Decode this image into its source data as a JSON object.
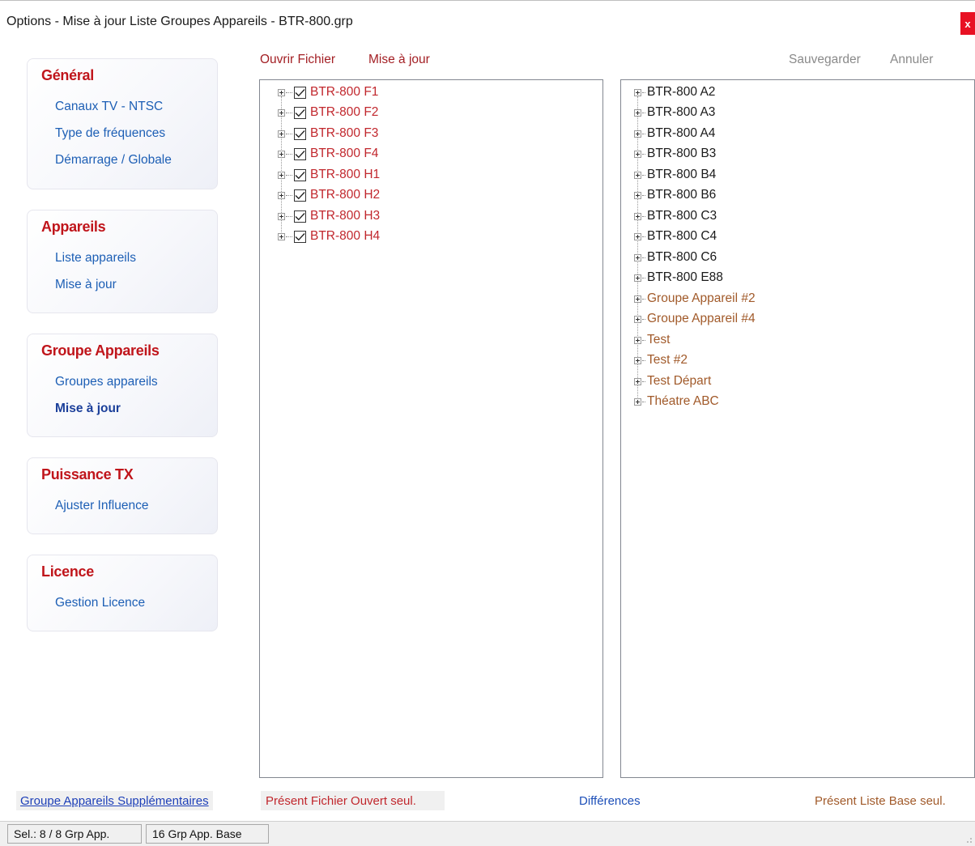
{
  "window": {
    "title": "Options - Mise à jour Liste Groupes Appareils  -  BTR-800.grp",
    "close_label": "x"
  },
  "sidebar": {
    "sections": [
      {
        "title": "Général",
        "items": [
          "Canaux TV - NTSC",
          "Type de fréquences",
          "Démarrage / Globale"
        ]
      },
      {
        "title": "Appareils",
        "items": [
          "Liste appareils",
          "Mise à jour"
        ]
      },
      {
        "title": "Groupe Appareils",
        "items": [
          "Groupes appareils",
          "Mise à jour"
        ],
        "active_item": "Mise à jour"
      },
      {
        "title": "Puissance TX",
        "items": [
          "Ajuster Influence"
        ]
      },
      {
        "title": "Licence",
        "items": [
          "Gestion Licence"
        ]
      }
    ]
  },
  "toolbar": {
    "open_file": "Ouvrir Fichier",
    "update": "Mise à jour",
    "save": "Sauvegarder",
    "cancel": "Annuler"
  },
  "left_tree": {
    "items": [
      "BTR-800 F1",
      "BTR-800 F2",
      "BTR-800 F3",
      "BTR-800 F4",
      "BTR-800 H1",
      "BTR-800 H2",
      "BTR-800 H3",
      "BTR-800 H4"
    ],
    "checked": [
      true,
      true,
      true,
      true,
      true,
      true,
      true,
      true
    ]
  },
  "right_tree": {
    "items": [
      {
        "label": "BTR-800 A2",
        "kind": "base"
      },
      {
        "label": "BTR-800 A3",
        "kind": "base"
      },
      {
        "label": "BTR-800 A4",
        "kind": "base"
      },
      {
        "label": "BTR-800 B3",
        "kind": "base"
      },
      {
        "label": "BTR-800 B4",
        "kind": "base"
      },
      {
        "label": "BTR-800 B6",
        "kind": "base"
      },
      {
        "label": "BTR-800 C3",
        "kind": "base"
      },
      {
        "label": "BTR-800 C4",
        "kind": "base"
      },
      {
        "label": "BTR-800 C6",
        "kind": "base"
      },
      {
        "label": "BTR-800 E88",
        "kind": "base"
      },
      {
        "label": "Groupe Appareil #2",
        "kind": "base-only"
      },
      {
        "label": "Groupe Appareil #4",
        "kind": "base-only"
      },
      {
        "label": "Test",
        "kind": "base-only"
      },
      {
        "label": "Test #2",
        "kind": "base-only"
      },
      {
        "label": "Test Départ",
        "kind": "base-only"
      },
      {
        "label": "Théatre ABC",
        "kind": "base-only"
      }
    ]
  },
  "legend": {
    "extra_groups": "Groupe Appareils Supplémentaires",
    "only_open_file": "Présent Fichier Ouvert seul.",
    "differences": "Différences",
    "only_base": "Présent Liste Base seul."
  },
  "colors": {
    "accent_red": "#c0151b",
    "link_blue": "#1d5fb5",
    "file_only_red": "#c1272d",
    "base_only_brown": "#a15a2a"
  },
  "statusbar": {
    "selection": "Sel.: 8 / 8 Grp App.",
    "base_count": "16 Grp App. Base"
  }
}
